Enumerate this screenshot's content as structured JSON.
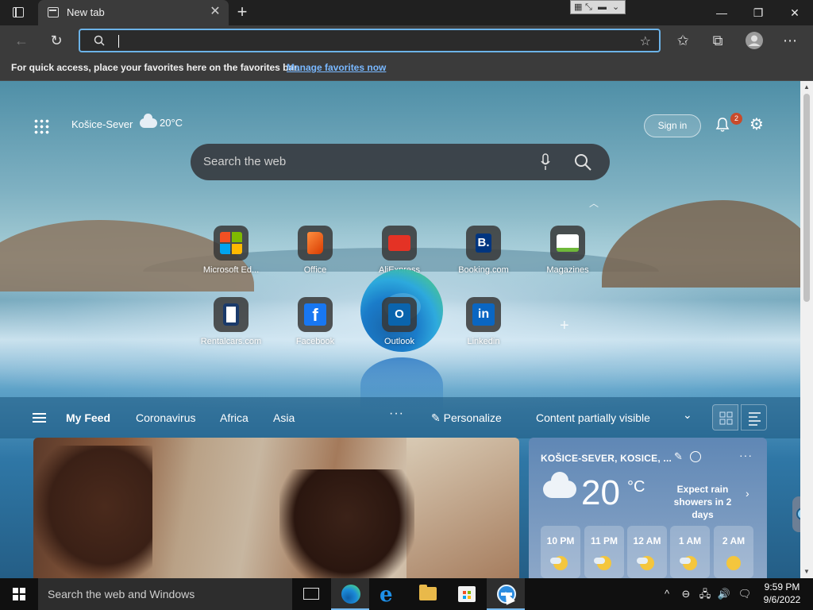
{
  "browser": {
    "tab_title": "New tab",
    "new_tab_symbol": "+",
    "close_tab_symbol": "✕",
    "window_controls": {
      "minimize": "—",
      "maximize": "❐",
      "close": "✕"
    },
    "address_bar": {
      "value": "",
      "placeholder": ""
    },
    "favorites_bar": {
      "message": "For quick access, place your favorites here on the favorites bar.",
      "link": "Manage favorites now"
    }
  },
  "newtab": {
    "location": "Košice-Sever",
    "temperature": "20°C",
    "sign_in": "Sign in",
    "notification_count": "2",
    "search_placeholder": "Search the web",
    "quick_links": [
      {
        "label": "Microsoft Ed...",
        "icon": "microsoft-logo-icon",
        "color": "#ffffff"
      },
      {
        "label": "Office",
        "icon": "office-icon",
        "color": "#d83b01"
      },
      {
        "label": "AliExpress",
        "icon": "aliexpress-icon",
        "color": "#e43225"
      },
      {
        "label": "Booking.com",
        "icon": "booking-icon",
        "color": "#003580"
      },
      {
        "label": "Magazines",
        "icon": "magazines-icon",
        "color": "#ffffff"
      },
      {
        "label": "Rentalcars.com",
        "icon": "rentalcars-icon",
        "color": "#ffffff"
      },
      {
        "label": "Facebook",
        "icon": "facebook-icon",
        "color": "#1877f2"
      },
      {
        "label": "Outlook",
        "icon": "outlook-icon",
        "color": "#0a64ad"
      },
      {
        "label": "Linkedin",
        "icon": "linkedin-icon",
        "color": "#0a66c2"
      }
    ],
    "feed_nav": {
      "items": [
        "My Feed",
        "Coronavirus",
        "Africa",
        "Asia"
      ],
      "more": "···",
      "personalize": "Personalize",
      "visibility": "Content partially visible"
    },
    "weather_card": {
      "location": "KOŠICE-SEVER, KOSICE, ...",
      "temperature": "20",
      "unit": "°C",
      "forecast": "Expect rain showers in 2 days",
      "hours": [
        {
          "time": "10 PM",
          "icon": "cloudy-moon-icon"
        },
        {
          "time": "11 PM",
          "icon": "cloudy-moon-icon"
        },
        {
          "time": "12 AM",
          "icon": "cloudy-moon-icon"
        },
        {
          "time": "1 AM",
          "icon": "cloudy-moon-icon"
        },
        {
          "time": "2 AM",
          "icon": "moon-icon"
        }
      ]
    }
  },
  "taskbar": {
    "search_placeholder": "Search the web and Windows",
    "time": "9:59 PM",
    "date": "9/6/2022"
  }
}
